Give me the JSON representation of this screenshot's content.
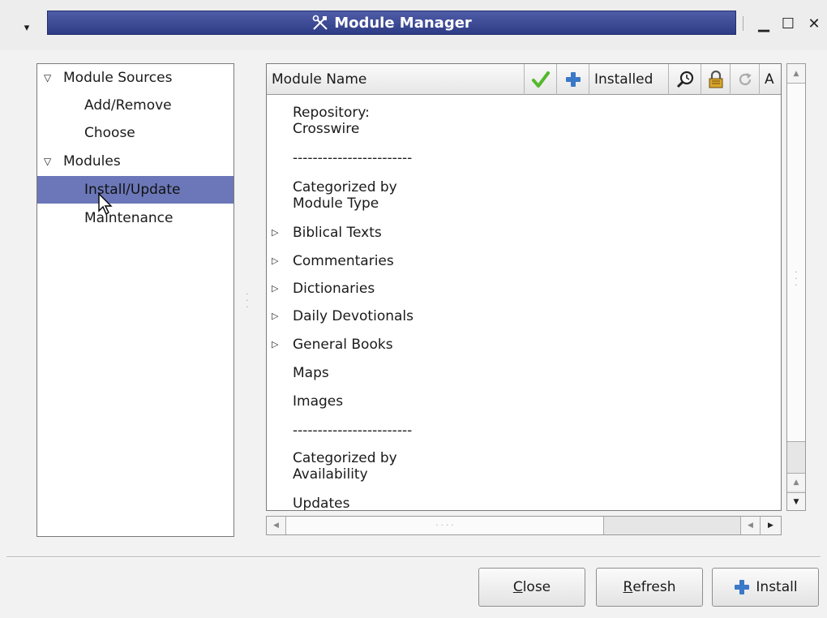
{
  "window": {
    "title": "Module Manager",
    "menu_glyph": "▾",
    "minimize_glyph": "▁",
    "maximize_glyph": "☐",
    "close_glyph": "✕"
  },
  "tree": {
    "items": [
      {
        "label": "Module Sources",
        "expanded": true
      },
      {
        "label": "Add/Remove"
      },
      {
        "label": "Choose"
      },
      {
        "label": "Modules",
        "expanded": true
      },
      {
        "label": "Install/Update",
        "selected": true
      },
      {
        "label": "Maintenance"
      }
    ]
  },
  "list": {
    "columns": [
      "Module Name",
      "Installed",
      "A"
    ],
    "column_icons": [
      "checkmark-icon",
      "plus-icon",
      "magnifier-icon",
      "lock-icon",
      "refresh-icon"
    ],
    "rows": [
      {
        "text": "Repository:\nCrosswire"
      },
      {
        "text": "------------------------"
      },
      {
        "text": "Categorized by\nModule Type"
      },
      {
        "text": "Biblical Texts",
        "expandable": true
      },
      {
        "text": "Commentaries",
        "expandable": true
      },
      {
        "text": "Dictionaries",
        "expandable": true
      },
      {
        "text": "Daily Devotionals",
        "expandable": true
      },
      {
        "text": "General Books",
        "expandable": true
      },
      {
        "text": "Maps"
      },
      {
        "text": "Images"
      },
      {
        "text": "------------------------"
      },
      {
        "text": "Categorized by\nAvailability"
      },
      {
        "text": "Updates"
      }
    ]
  },
  "buttons": {
    "close": "Close",
    "close_mnemonic": "C",
    "close_rest": "lose",
    "refresh": "Refresh",
    "refresh_mnemonic": "R",
    "refresh_rest": "efresh",
    "install": "Install"
  },
  "colors": {
    "title_bar": "#3a4892",
    "selection": "#6b77b8",
    "check_green": "#54b82c",
    "plus_blue": "#3a78c8"
  }
}
